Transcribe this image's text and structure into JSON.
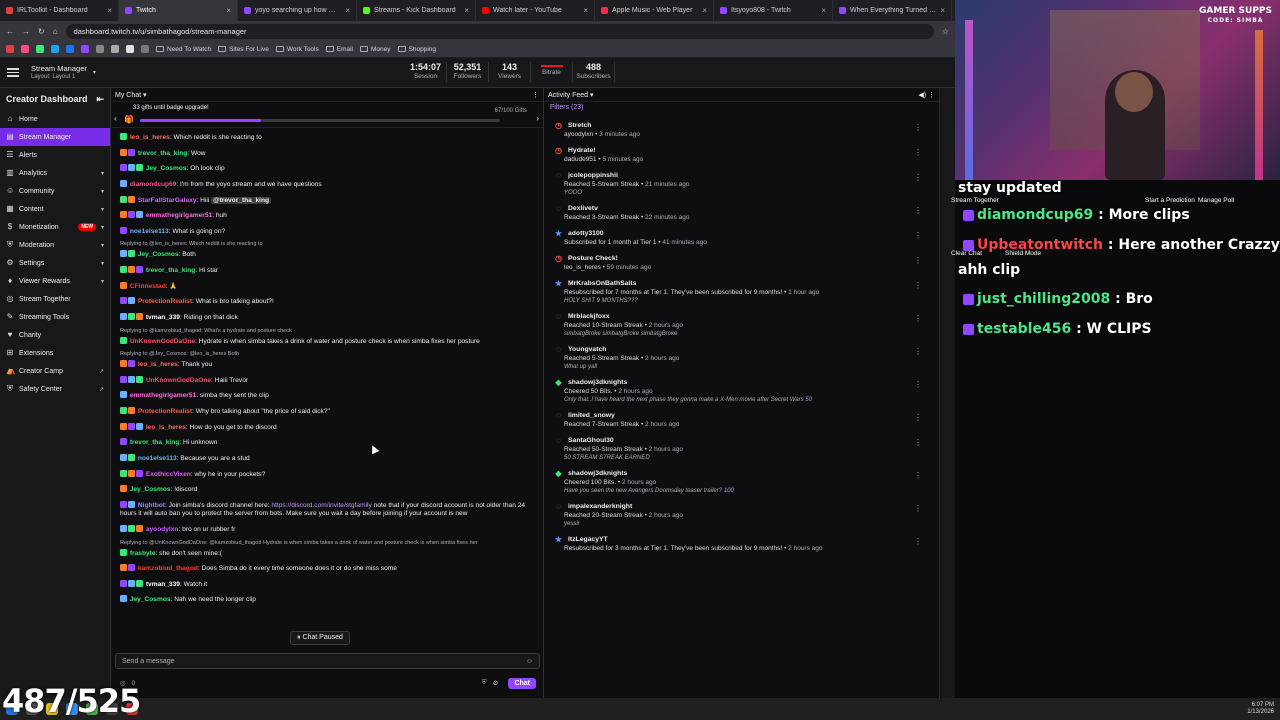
{
  "browser": {
    "tabs": [
      {
        "label": "IRLToolkit - Dashboard",
        "color": "#e04040"
      },
      {
        "label": "Twitch",
        "color": "#9147ff",
        "active": true
      },
      {
        "label": "yoyo searching up how much li",
        "color": "#9147ff"
      },
      {
        "label": "Streams - Kick Dashboard",
        "color": "#53fc18"
      },
      {
        "label": "Watch later - YouTube",
        "color": "#ff0000"
      },
      {
        "label": "Apple Music - Web Player",
        "color": "#fa2d48"
      },
      {
        "label": "Itsyoyo808 - Twitch",
        "color": "#9147ff"
      },
      {
        "label": "When Everything Turned Pink",
        "color": "#9147ff"
      }
    ],
    "url": "dashboard.twitch.tv/u/simbathagod/stream-manager",
    "bookmarks": [
      "Need To Watch",
      "Sites For Live",
      "Work Tools",
      "Email",
      "Money",
      "Shopping"
    ]
  },
  "header": {
    "title": "Stream Manager",
    "layout": "Layout: Layout 1",
    "stats": [
      {
        "value": "1:54:07",
        "label": "Session"
      },
      {
        "value": "52,351",
        "label": "Followers"
      },
      {
        "value": "143",
        "label": "Viewers"
      },
      {
        "value": "",
        "label": "Bitrate"
      },
      {
        "value": "488",
        "label": "Subscribers"
      }
    ]
  },
  "sidebar": {
    "title": "Creator Dashboard",
    "items": [
      {
        "label": "Home",
        "icon": "home-icon",
        "glyph": "⌂"
      },
      {
        "label": "Stream Manager",
        "icon": "stream-manager-icon",
        "glyph": "▤",
        "active": true
      },
      {
        "label": "Alerts",
        "icon": "alerts-icon",
        "glyph": "☰"
      },
      {
        "label": "Analytics",
        "icon": "analytics-icon",
        "glyph": "▥",
        "chevron": true
      },
      {
        "label": "Community",
        "icon": "community-icon",
        "glyph": "☺",
        "chevron": true
      },
      {
        "label": "Content",
        "icon": "content-icon",
        "glyph": "▦",
        "chevron": true
      },
      {
        "label": "Monetization",
        "icon": "monetization-icon",
        "glyph": "$",
        "chevron": true,
        "badge": "NEW"
      },
      {
        "label": "Moderation",
        "icon": "moderation-icon",
        "glyph": "⛨",
        "chevron": true
      },
      {
        "label": "Settings",
        "icon": "settings-icon",
        "glyph": "⚙",
        "chevron": true
      },
      {
        "label": "Viewer Rewards",
        "icon": "viewer-rewards-icon",
        "glyph": "♦",
        "chevron": true
      },
      {
        "label": "Stream Together",
        "icon": "stream-together-icon",
        "glyph": "◎"
      },
      {
        "label": "Streaming Tools",
        "icon": "streaming-tools-icon",
        "glyph": "✎"
      },
      {
        "label": "Charity",
        "icon": "charity-icon",
        "glyph": "♥"
      },
      {
        "label": "Extensions",
        "icon": "extensions-icon",
        "glyph": "⊞"
      },
      {
        "label": "Creator Camp",
        "icon": "creator-camp-icon",
        "glyph": "⛺",
        "external": true
      },
      {
        "label": "Safety Center",
        "icon": "safety-center-icon",
        "glyph": "⛨",
        "external": true
      }
    ]
  },
  "chat": {
    "title": "My Chat",
    "gift_text": "33 gifts until badge upgrade!",
    "gift_count": "67/100 Gifts",
    "gift_progress": 0.67,
    "messages": [
      {
        "name": "leo_is_heres",
        "color": "#ff6a5e",
        "text": ": Which reddit is she reacting to"
      },
      {
        "name": "trevor_tha_king",
        "color": "#3ee67a",
        "text": ": Wow"
      },
      {
        "name": "Jey_Cosmos",
        "color": "#3ee67a",
        "text": ": Oh look clip"
      },
      {
        "name": "diamondcup69",
        "color": "#ff4a8a",
        "text": ": I'm from the yoyo stream and we have questions"
      },
      {
        "name": "StarFallStarGalaxy",
        "color": "#d162ff",
        "text": ": Hiii ",
        "mention": "@trevor_tha_king"
      },
      {
        "name": "emmathegirlgamer51",
        "color": "#ff6adf",
        "text": ": huh"
      },
      {
        "name": "noe1else113",
        "color": "#6ab0ff",
        "text": ": What is going on?"
      },
      {
        "reply": "Replying to @leo_is_heres: Which reddit is she reacting to",
        "name": "Jey_Cosmos",
        "color": "#3ee67a",
        "text": ": Both"
      },
      {
        "name": "trevor_tha_king",
        "color": "#3ee67a",
        "text": ": Hi star"
      },
      {
        "name": "CFinnestad",
        "color": "#ff3a3a",
        "text": ": 🙏"
      },
      {
        "name": "ProtectionRealist",
        "color": "#ff5b3a",
        "text": ": What is bro talking about?!"
      },
      {
        "name": "tvman_339",
        "color": "#ffffff",
        "text": ": Riding on that dick"
      },
      {
        "reply": "Replying to @kamzobiud_thagod: What's a hydrate and posture check",
        "name": "UnKnownGodDaOne",
        "color": "#ff4a6a",
        "text": ": Hydrate is when simba takes a drink of water and posture check is when simba fixes her posture",
        "wrap": true
      },
      {
        "reply": "Replying to @Jey_Cosmos: @leo_is_heres Both",
        "name": "leo_is_heres",
        "color": "#ff6a5e",
        "text": ": Thank you"
      },
      {
        "name": "UnKnownGodDaOne",
        "color": "#ff4a6a",
        "text": ": Haiii Trevor"
      },
      {
        "name": "emmathegirlgamer51",
        "color": "#ff6adf",
        "text": ": simba they sent the clip"
      },
      {
        "name": "ProtectionRealist",
        "color": "#ff5b3a",
        "text": ": Why bro talking about \"the price of said dick?\""
      },
      {
        "name": "leo_is_heres",
        "color": "#ff6a5e",
        "text": ": How do you get to the discord"
      },
      {
        "name": "trevor_tha_king",
        "color": "#3ee67a",
        "text": ": Hi unknown"
      },
      {
        "name": "noe1else113",
        "color": "#6ab0ff",
        "text": ": Because you are a stud"
      },
      {
        "name": "ExothiccVixen",
        "color": "#d162ff",
        "text": ": why he in your pockets?"
      },
      {
        "name": "Jey_Cosmos",
        "color": "#3ee67a",
        "text": ": !discord"
      },
      {
        "name": "Nightbot",
        "color": "#8a8aff",
        "text": ": Join simba's discord channel here: ",
        "link": "https://discord.com/invite/stgfamily",
        "text2": " note that if your discord account is not older than 24 hours it will auto ban you to protect the server from bots. Make sure you wait a day before joining if your account is new",
        "wrap": true
      },
      {
        "name": "ayoodylxn",
        "color": "#c45cff",
        "text": ": bro on ur rubber fr"
      },
      {
        "reply": "Replying to @UnKnownGodDaOne: @kamzobiud_thagod Hydrate is when simba takes a drink of water and posture check is when simba fixes her",
        "name": "frasbyte",
        "color": "#3ee67a",
        "text": ": she don't seen mine:("
      },
      {
        "name": "kamzobiud_thagod",
        "color": "#ff3a3a",
        "text": ": Does Simba do it every time someone does it or do she miss some"
      },
      {
        "name": "tvman_339",
        "color": "#ffffff",
        "text": ": Watch it"
      },
      {
        "name": "Jey_Cosmos",
        "color": "#3ee67a",
        "text": ": Nah we need the longer clip"
      }
    ],
    "paused": "Chat Paused",
    "input_placeholder": "Send a message",
    "points": "0",
    "send_label": "Chat"
  },
  "activity": {
    "title": "Activity Feed",
    "filters": "Filters (23)",
    "items": [
      {
        "icon": "clock-icon",
        "glyph": "◷",
        "color": "#ff4f4d",
        "user": "Stretch",
        "line": "ayoodylxn",
        "ago": "3 minutes ago"
      },
      {
        "icon": "clock-icon",
        "glyph": "◷",
        "color": "#ff4f4d",
        "user": "Hydrate!",
        "line": "dadude951",
        "ago": "5 minutes ago"
      },
      {
        "icon": "streak-icon",
        "glyph": "◌",
        "color": "#ff4f4d",
        "user": "jcolepoppinshii",
        "line": "Reached 5-Stream Streak",
        "ago": "21 minutes ago",
        "msg": "YOOO"
      },
      {
        "icon": "streak-icon",
        "glyph": "◌",
        "color": "#ff4f4d",
        "user": "Dexlivetv",
        "line": "Reached 3-Stream Streak",
        "ago": "22 minutes ago"
      },
      {
        "icon": "sub-icon",
        "glyph": "★",
        "color": "#6a8cff",
        "user": "adotty3100",
        "line": "Subscribed for 1 month at Tier 1",
        "ago": "41 minutes ago"
      },
      {
        "icon": "clock-icon",
        "glyph": "◷",
        "color": "#ff4f4d",
        "user": "Posture Check!",
        "line": "leo_is_heres",
        "ago": "59 minutes ago"
      },
      {
        "icon": "sub-icon",
        "glyph": "★",
        "color": "#6a8cff",
        "user": "MrKrabsOnBathSalts",
        "line": "Resubscribed for 7 months at Tier 1. They've been subscribed for 9 months!",
        "ago": "1 hour ago",
        "msg": "HOLY SHIT 9 MONTHS???"
      },
      {
        "icon": "streak-icon",
        "glyph": "◌",
        "color": "#ff4f4d",
        "user": "Mrblackjfoxx",
        "line": "Reached 10-Stream Streak",
        "ago": "2 hours ago",
        "msg": "simbatgBroke simbatgBroke simbatgBroke"
      },
      {
        "icon": "streak-icon",
        "glyph": "◌",
        "color": "#ff4f4d",
        "user": "Youngvatch",
        "line": "Reached 5-Stream Streak",
        "ago": "2 hours ago",
        "msg": "What up yall"
      },
      {
        "icon": "bits-icon",
        "glyph": "◆",
        "color": "#3ee67a",
        "user": "shadowj3dknights",
        "line": "Cheered 50 Bits.",
        "ago": "2 hours ago",
        "msg": "Only that..I have heard the next phase they gonna make a X-Men movie after Secret Wars",
        "bits": "50"
      },
      {
        "icon": "streak-icon",
        "glyph": "◌",
        "color": "#ff4f4d",
        "user": "limited_snowy",
        "line": "Reached 7-Stream Streak",
        "ago": "2 hours ago"
      },
      {
        "icon": "streak-icon",
        "glyph": "◌",
        "color": "#ff4f4d",
        "user": "SantaGhoul30",
        "line": "Reached 50-Stream Streak",
        "ago": "2 hours ago",
        "msg": "50 STREAM STREAK EARNED"
      },
      {
        "icon": "bits-icon",
        "glyph": "◆",
        "color": "#3ee67a",
        "user": "shadowj3dknights",
        "line": "Cheered 100 Bits.",
        "ago": "2 hours ago",
        "msg": "Have you seen the new Avengers Doomsday teaser trailer?",
        "bits": "100"
      },
      {
        "icon": "streak-icon",
        "glyph": "◌",
        "color": "#ff4f4d",
        "user": "impalexanderknight",
        "line": "Reached 20-Stream Streak",
        "ago": "2 hours ago",
        "msg": "yessir"
      },
      {
        "icon": "sub-icon",
        "glyph": "★",
        "color": "#6a8cff",
        "user": "ItzLegacyYT",
        "line": "Resubscribed for 3 months at Tier 1. They've been subscribed for 9 months!",
        "ago": "2 hours ago"
      }
    ]
  },
  "overlay": {
    "logo_top": "GAMER SUPPS",
    "logo_sub": "CODE: SIMBA",
    "buttons": [
      "Stream Together",
      "Start a Prediction",
      "Manage Poll",
      "Clear Chat",
      "Shield Mode"
    ],
    "chat": [
      {
        "name": "",
        "text": "stay updated"
      },
      {
        "name": "diamondcup69",
        "text": " : More clips"
      },
      {
        "name": "Upbeatontwitch",
        "text": " : Here another Crazzy",
        "red": true
      },
      {
        "name": "",
        "text": "ahh clip"
      },
      {
        "name": "just_chilling2008",
        "text": " : Bro"
      },
      {
        "name": "testable456",
        "text": " : W CLIPS"
      }
    ]
  },
  "counter": "487/525",
  "taskbar": {
    "time": "6:07 PM",
    "date": "1/13/2026"
  }
}
